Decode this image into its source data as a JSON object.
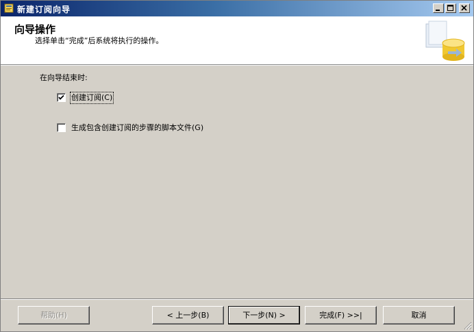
{
  "window": {
    "title": "新建订阅向导"
  },
  "header": {
    "title": "向导操作",
    "subtitle": "选择单击“完成”后系统将执行的操作。"
  },
  "body": {
    "section_label": "在向导结束时:",
    "options": [
      {
        "label": "创建订阅(C)",
        "checked": true
      },
      {
        "label": "生成包含创建订阅的步骤的脚本文件(G)",
        "checked": false
      }
    ]
  },
  "buttons": {
    "help": "帮助(H)",
    "back": "< 上一步(B)",
    "next": "下一步(N) >",
    "finish": "完成(F) >>|",
    "cancel": "取消"
  },
  "colors": {
    "titlebar_start": "#0a246a",
    "titlebar_end": "#a6caf0",
    "dialog_face": "#d4d0c8"
  }
}
